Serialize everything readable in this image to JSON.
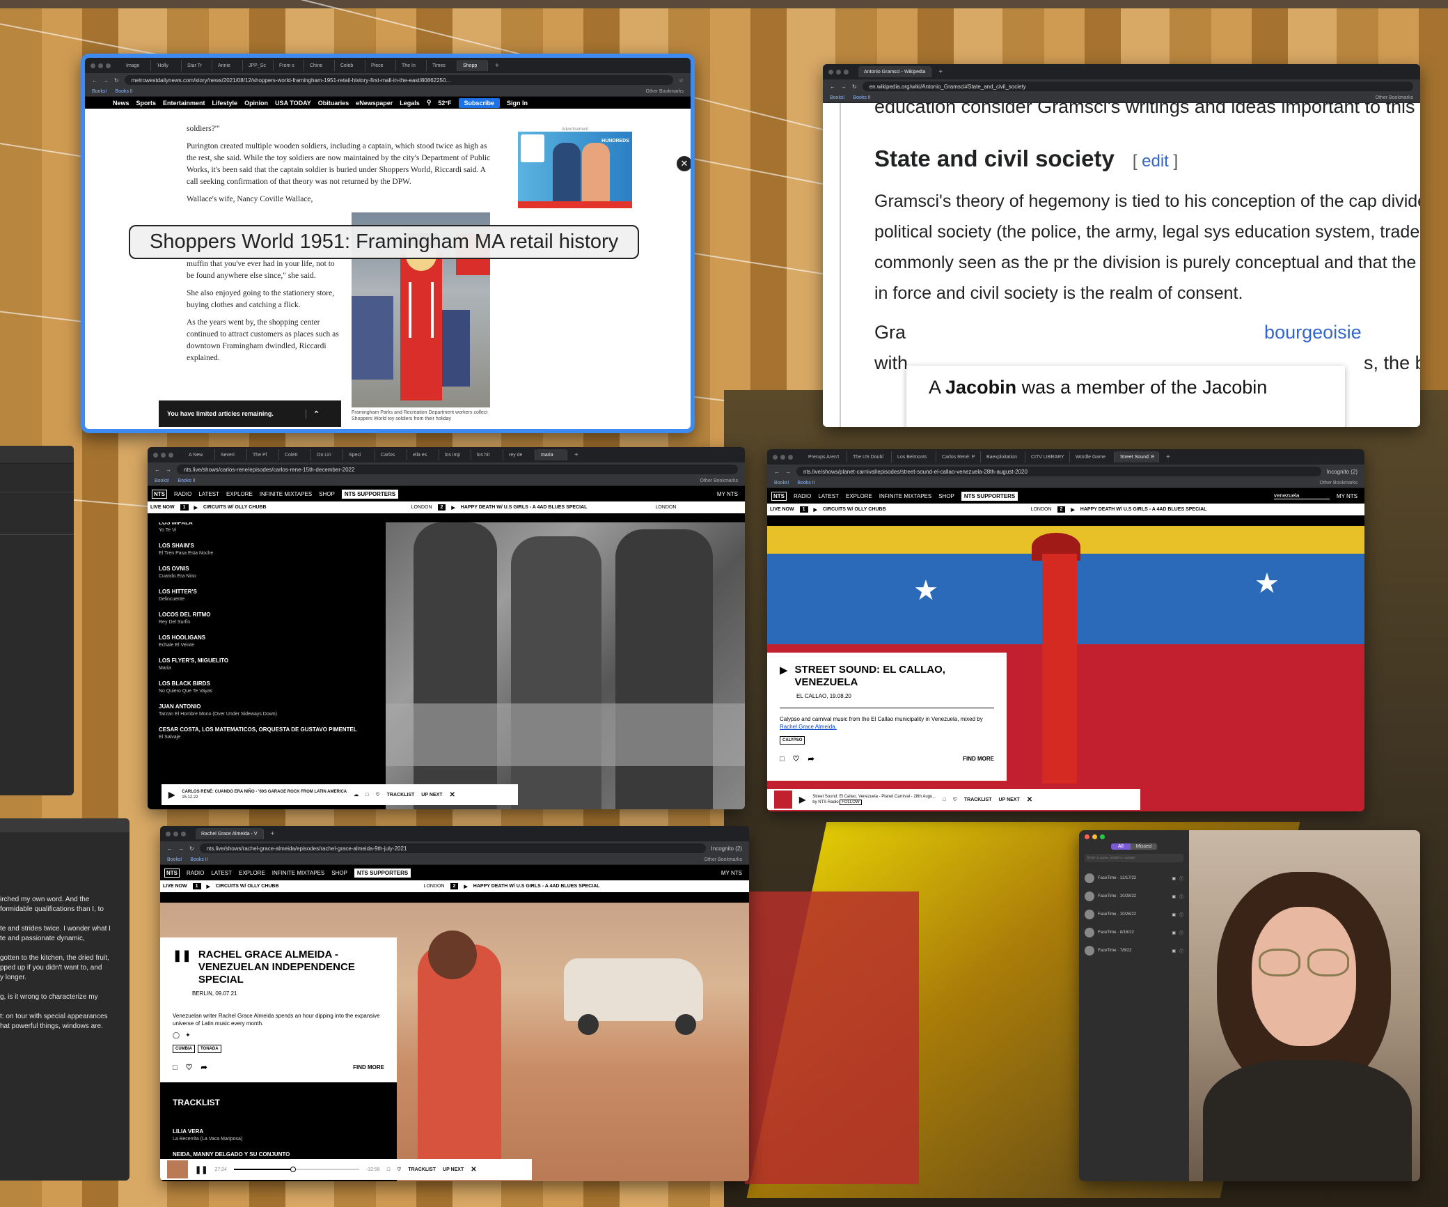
{
  "news_window": {
    "tabs": [
      "Image",
      "'Holly",
      "Star Tr",
      "Annie",
      "JPP_Sc",
      "From s",
      "Chine",
      "Celeb",
      "Piece",
      "The In",
      "Times",
      "Shopp"
    ],
    "url": "metrowestdailynews.com/story/news/2021/08/12/shoppers-world-framingham-1951-retail-history-first-mall-in-the-east/80862250...",
    "bookmarks": [
      "Books!",
      "Books II"
    ],
    "other_bookmarks": "Other Bookmarks",
    "nav": [
      "News",
      "Sports",
      "Entertainment",
      "Lifestyle",
      "Opinion",
      "USA TODAY",
      "Obituaries",
      "eNewspaper",
      "Legals"
    ],
    "temp": "52°F",
    "subscribe": "Subscribe",
    "signin": "Sign In",
    "frag": "soldiers?'\"",
    "p1": "Purington created multiple wooden soldiers, including a captain, which stood twice as high as the rest, she said. While the toy soldiers are now maintained by the city's Department of Public Works, it's been said that the captain soldier is buried under Shoppers World, Riccardi said. A call seeking confirmation of that theory was not returned by the DPW.",
    "p2": "Wallace's wife, Nancy Coville Wallace,",
    "p3": "muffin that you've ever had in your life, not to be found anywhere else since,\" she said.",
    "p4": "She also enjoyed going to the stationery store, buying clothes and catching a flick.",
    "p5": "As the years went by, the shopping center continued to attract customers as places such as downtown Framingham dwindled, Riccardi explained.",
    "ad_label": "Advertisement",
    "ad_text": "HUNDREDS",
    "banner": "You have limited articles remaining.",
    "caption": "Framingham Parks and Recreation Department workers collect Shoppers World toy soldiers from their holiday",
    "tooltip": "Shoppers World 1951: Framingham MA retail history"
  },
  "wiki_window": {
    "tab": "Antonio Gramsci - Wikipedia",
    "url": "en.wikipedia.org/wiki/Antonio_Gramsci#State_and_civil_society",
    "bookmarks": [
      "Books!",
      "Books II"
    ],
    "other_bookmarks": "Other Bookmarks",
    "top_cut": "education consider Gramsci's writings and ideas important to this",
    "heading": "State and civil society",
    "edit": "edit",
    "para": "Gramsci's theory of hegemony is tied to his conception of the cap divides it between political society (the police, the army, legal sys education system, trade unions, etc.) – commonly seen as the pr the division is purely conceptual and that the two often overlap in force and civil society is the realm of consent.",
    "para2_a": "Gra",
    "para2_link": "bourgeoisie",
    "para2_b": "with",
    "para2_c": "s, the bo",
    "popup_a": "A ",
    "popup_b": "Jacobin",
    "popup_c": " was a member of the Jacobin"
  },
  "nts1": {
    "tabs": [
      "A New",
      "Severi",
      "The Pl",
      "Colett",
      "On Lin",
      "Speci",
      "Carlos",
      "ella es",
      "los imp",
      "los hit",
      "rey de",
      "maria"
    ],
    "url": "nts.live/shows/carlos-rene/episodes/carlos-rene-15th-december-2022",
    "nav": [
      "RADIO",
      "LATEST",
      "EXPLORE",
      "INFINITE MIXTAPES",
      "SHOP"
    ],
    "supporters": "NTS SUPPORTERS",
    "mynts": "MY NTS",
    "live": "LIVE NOW",
    "ch1": "CIRCUITS W/ OLLY CHUBB",
    "ch2": "HAPPY DEATH W/ U.S GIRLS - A 4AD BLUES SPECIAL",
    "london": "LONDON",
    "tracks": [
      {
        "a": "LOS IMPALA",
        "t": "Yo Te Vi"
      },
      {
        "a": "LOS SHAIN'S",
        "t": "El Tren Pasa Esta Noche"
      },
      {
        "a": "LOS OVNIS",
        "t": "Cuando Era Nino"
      },
      {
        "a": "LOS HITTER'S",
        "t": "Delincuente"
      },
      {
        "a": "LOCOS DEL RITMO",
        "t": "Rey Del Surfin"
      },
      {
        "a": "LOS HOOLIGANS",
        "t": "Echale El Veinte"
      },
      {
        "a": "LOS FLYER'S, MIGUELITO",
        "t": "Maria"
      },
      {
        "a": "LOS BLACK BIRDS",
        "t": "No Quiero Que Te Vayas"
      },
      {
        "a": "JUAN ANTONIO",
        "t": "Tarzan El Hombre Mono (Over Under Sideways Down)"
      },
      {
        "a": "CESAR COSTA, LOS MATEMATICOS, ORQUESTA DE GUSTAVO PIMENTEL",
        "t": "El Salvaje"
      }
    ],
    "player_title": "CARLOS RENÉ: CUANDO ERA NIÑO - '60S GARAGE ROCK FROM LATIN AMERICA",
    "player_date": "15.12.22",
    "tracklist": "TRACKLIST",
    "upnext": "UP NEXT"
  },
  "nts2": {
    "tabs": [
      "Prerups Aren't",
      "The US Doubl",
      "Los Belmonts",
      "Carlos René: P",
      "Baexploitation",
      "CITV LIBRARY",
      "Wordle Game",
      "Street Sound: E"
    ],
    "url": "nts.live/shows/planet-carnival/episodes/street-sound-el-callao-venezuela-28th-august-2020",
    "incognito": "Incognito (2)",
    "search": "venezuela",
    "title": "STREET SOUND: EL CALLAO, VENEZUELA",
    "meta": "EL CALLAO, 19.08.20",
    "desc": "Calypso and carnival music from the El Callao municipality in Venezuela, mixed by",
    "link": "Rachel Grace Almeida.",
    "tag": "CALYPSO",
    "findmore": "FIND MORE",
    "player_title": "Street Sound: El Callao, Venezuela - Planet Carnival - 28th Augu...",
    "player_by": "by NTS Radio",
    "follow": "FOLLOW"
  },
  "nts3": {
    "tab": "Rachel Grace Almeida - V",
    "url": "nts.live/shows/rachel-grace-almeida/episodes/rachel-grace-almeida-9th-july-2021",
    "title": "RACHEL GRACE ALMEIDA - VENEZUELAN INDEPENDENCE SPECIAL",
    "meta": "BERLIN, 09.07.21",
    "desc": "Venezuelan writer Rachel Grace Almeida spends an hour dipping into the expansive universe of Latin music every month.",
    "tags": [
      "CUMBIA",
      "TONADA"
    ],
    "findmore": "FIND MORE",
    "tracklist_head": "TRACKLIST",
    "t1a": "LILIA VERA",
    "t1t": "La Becerrita (La Vaca Mariposa)",
    "t2a": "NEIDA, MANNY DELGADO Y SU CONJUNTO",
    "time_a": "27:24",
    "time_b": "-32:56"
  },
  "facetime": {
    "seg_all": "All",
    "seg_missed": "Missed",
    "search": "Enter a name, email or number",
    "calls": [
      "FaceTime · 12/17/22",
      "FaceTime · 10/28/22",
      "FaceTime · 10/26/22",
      "FaceTime · 8/16/22",
      "FaceTime · 7/8/22"
    ]
  },
  "notes": {
    "lines": [
      "irched my own word. And the",
      "formidable qualifications than I, to",
      "",
      "te and strides twice. I wonder what I",
      "te and passionate dynamic,",
      "",
      "gotten to the kitchen, the dried fruit,",
      "pped up if you didn't want to, and",
      "y longer.",
      "",
      "g, is it wrong to characterize my",
      "",
      "t: on tour with special appearances",
      "hat powerful things, windows are."
    ]
  },
  "colors": {
    "accent_blue": "#3d8bf0",
    "nts_black": "#000000"
  }
}
